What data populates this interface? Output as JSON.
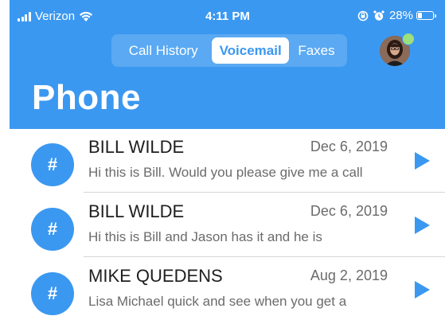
{
  "status_bar": {
    "carrier": "Verizon",
    "time": "4:11 PM",
    "battery_percent": "28%",
    "battery_level": 0.28,
    "icons": [
      "signal-icon",
      "wifi-icon",
      "screen-lock-icon",
      "alarm-icon",
      "battery-icon"
    ]
  },
  "tabs": [
    {
      "label": "Call History",
      "active": false
    },
    {
      "label": "Voicemail",
      "active": true
    },
    {
      "label": "Faxes",
      "active": false
    }
  ],
  "profile": {
    "presence": "online",
    "presence_color": "#9be07a"
  },
  "page_title": "Phone",
  "voicemails": [
    {
      "icon_text": "#",
      "name": "BILL WILDE",
      "date": "Dec 6, 2019",
      "preview": "Hi this is Bill. Would you please give me a call"
    },
    {
      "icon_text": "#",
      "name": "BILL WILDE",
      "date": "Dec 6, 2019",
      "preview": "Hi this is Bill and Jason has it and he is"
    },
    {
      "icon_text": "#",
      "name": "MIKE QUEDENS",
      "date": "Aug 2, 2019",
      "preview": "Lisa Michael quick and see when you get a"
    }
  ],
  "colors": {
    "accent": "#3b98f0",
    "tab_track": "#5aa9f2",
    "text_primary": "#1e1e1e",
    "text_secondary": "#6b6b6b"
  }
}
